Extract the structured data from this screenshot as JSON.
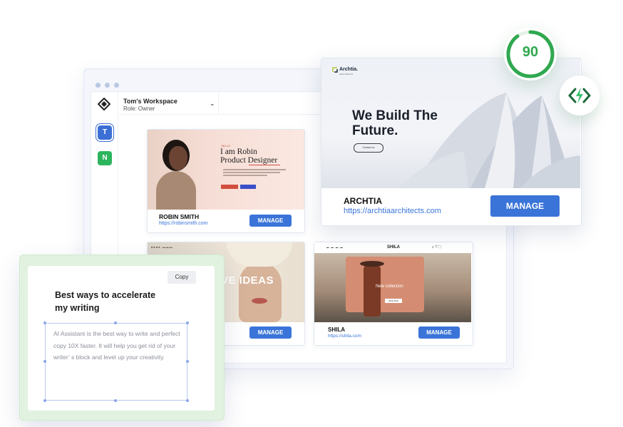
{
  "workspace": {
    "name": "Tom's Workspace",
    "role": "Role: Owner",
    "avatars": [
      {
        "letter": "T",
        "color": "#3b6fd6"
      },
      {
        "letter": "N",
        "color": "#2db55d"
      }
    ]
  },
  "sites": {
    "robin": {
      "hero_kicker": "HELLO",
      "hero_line1": "I am Robin",
      "hero_line2": "Product Designer",
      "name": "ROBIN SMITH",
      "url": "https://robinsmith.com",
      "manage": "MANAGE"
    },
    "ideas": {
      "hero_text": "VE IDEAS",
      "manage": "MANAGE"
    },
    "shila": {
      "logo": "SHILA",
      "banner": "New collection",
      "banner_button": "Shop Now",
      "name": "SHILA",
      "url": "https://shila.com",
      "manage": "MANAGE"
    },
    "archtia": {
      "logo": "Archtia.",
      "logo_sub": "ARCHITECTS",
      "headline_line1": "We Build The",
      "headline_line2": "Future.",
      "cta": "Contact us",
      "name": "ARCHTIA",
      "url": "https://archtiaarchitects.com",
      "manage": "MANAGE"
    }
  },
  "performance": {
    "score": "90",
    "score_progress": 0.9,
    "ring_color": "#2fa84f",
    "speed_icon": "lightning-bolt-icon"
  },
  "ai_writer": {
    "copy_label": "Copy",
    "title": "Best ways to accelerate my writing",
    "body": "AI Assistant is the best way to write and perfect copy 10X faster. It will help you get rid of your writer’ s block and level up your creativity."
  },
  "colors": {
    "primary": "#3a74d8",
    "success": "#2fa84f"
  }
}
